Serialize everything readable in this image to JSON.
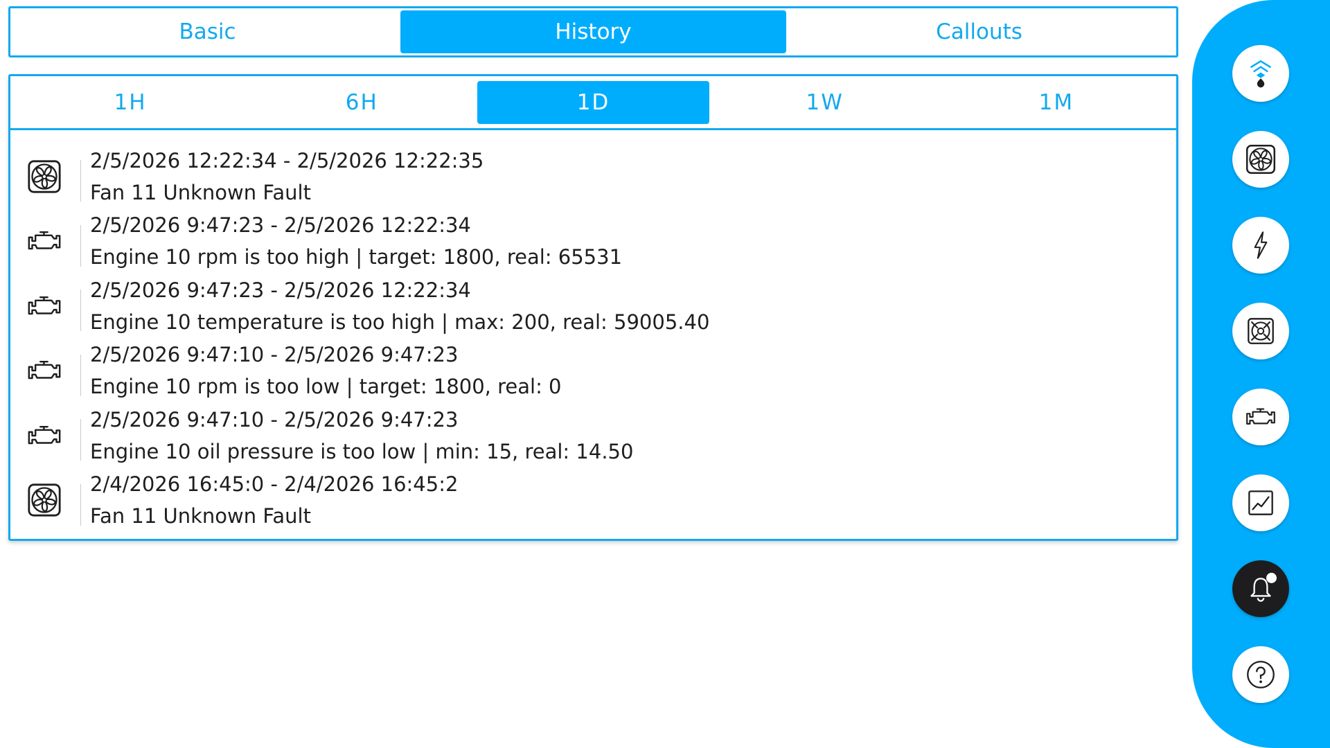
{
  "tabs": [
    {
      "label": "Basic",
      "active": false
    },
    {
      "label": "History",
      "active": true
    },
    {
      "label": "Callouts",
      "active": false
    }
  ],
  "ranges": [
    {
      "label": "1H",
      "active": false
    },
    {
      "label": "6H",
      "active": false
    },
    {
      "label": "1D",
      "active": true
    },
    {
      "label": "1W",
      "active": false
    },
    {
      "label": "1M",
      "active": false
    }
  ],
  "alarms": [
    {
      "icon": "fan-icon",
      "time": "2/5/2026 12:22:34 - 2/5/2026 12:22:35",
      "message": "Fan 11 Unknown Fault"
    },
    {
      "icon": "engine-icon",
      "time": "2/5/2026 9:47:23 - 2/5/2026 12:22:34",
      "message": "Engine 10 rpm is too high | target: 1800, real: 65531"
    },
    {
      "icon": "engine-icon",
      "time": "2/5/2026 9:47:23 - 2/5/2026 12:22:34",
      "message": "Engine 10 temperature is too high | max: 200, real: 59005.40"
    },
    {
      "icon": "engine-icon",
      "time": "2/5/2026 9:47:10 - 2/5/2026 9:47:23",
      "message": "Engine 10 rpm is too low | target: 1800, real: 0"
    },
    {
      "icon": "engine-icon",
      "time": "2/5/2026 9:47:10 - 2/5/2026 9:47:23",
      "message": "Engine 10 oil pressure is too low | min: 15, real: 14.50"
    },
    {
      "icon": "fan-icon",
      "time": "2/4/2026 16:45:0 - 2/4/2026 16:45:2",
      "message": "Fan 11 Unknown Fault"
    }
  ],
  "sidebar": [
    {
      "icon": "signal-drop-icon",
      "active": false
    },
    {
      "icon": "fan-icon",
      "active": false
    },
    {
      "icon": "lightning-icon",
      "active": false
    },
    {
      "icon": "pump-icon",
      "active": false
    },
    {
      "icon": "engine-icon",
      "active": false
    },
    {
      "icon": "chart-icon",
      "active": false
    },
    {
      "icon": "bell-icon",
      "active": true
    },
    {
      "icon": "help-icon",
      "active": false
    }
  ],
  "colors": {
    "accent": "#00adfc",
    "border": "#12a9ee",
    "active_nav": "#1d1d1f",
    "text": "#1e1e1e"
  }
}
